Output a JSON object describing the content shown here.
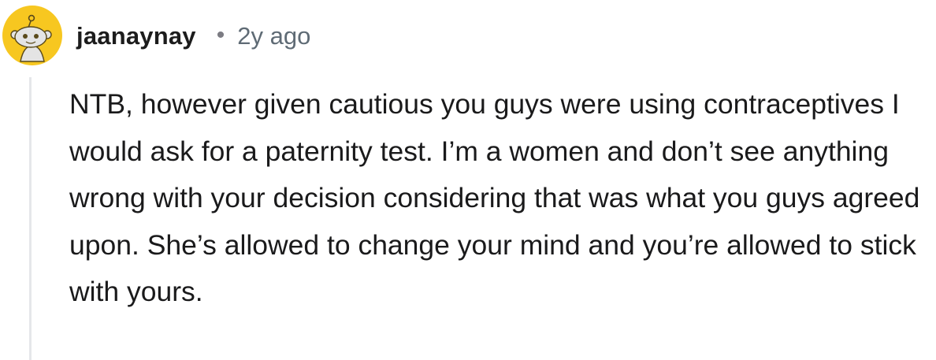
{
  "comment": {
    "author": "jaanaynay",
    "separator": "•",
    "timestamp": "2y ago",
    "body": "NTB, however given cautious you guys were using contraceptives I would ask for a paternity test. I’m a women and don’t see anything wrong with your decision considering that was what you guys agreed upon. She’s allowed to change your mind and you’re allowed to stick with yours."
  },
  "avatar": {
    "icon": "snoo-avatar-icon",
    "background_color": "#F7C720"
  }
}
